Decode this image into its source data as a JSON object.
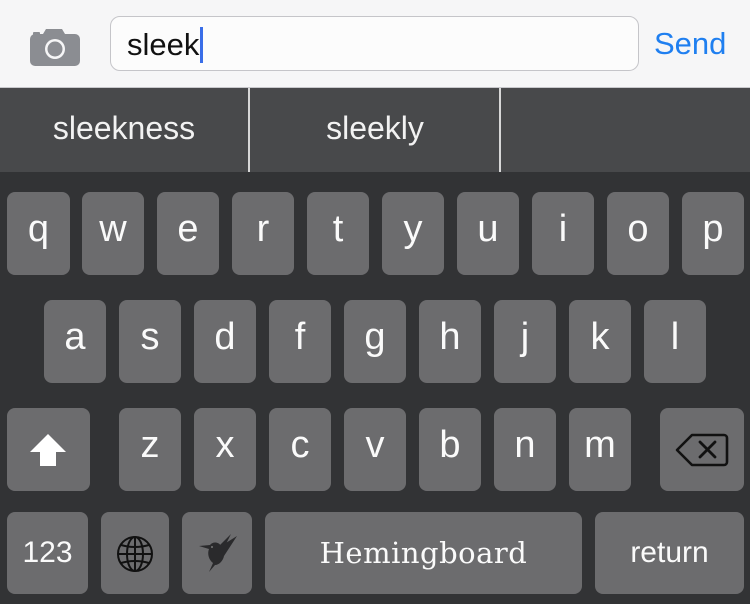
{
  "input_bar": {
    "camera_icon": "camera-icon",
    "text_value": "sleek",
    "send_label": "Send"
  },
  "suggestions": [
    "sleekness",
    "sleekly",
    ""
  ],
  "keyboard": {
    "row1": [
      "q",
      "w",
      "e",
      "r",
      "t",
      "y",
      "u",
      "i",
      "o",
      "p"
    ],
    "row2": [
      "a",
      "s",
      "d",
      "f",
      "g",
      "h",
      "j",
      "k",
      "l"
    ],
    "row3": [
      "z",
      "x",
      "c",
      "v",
      "b",
      "n",
      "m"
    ],
    "numbers_label": "123",
    "space_label": "Hemingboard",
    "return_label": "return",
    "shift_icon": "shift-icon",
    "delete_icon": "delete-icon",
    "globe_icon": "globe-icon",
    "hummingbird_icon": "hummingbird-icon"
  },
  "colors": {
    "accent": "#1f7ff0",
    "caret": "#3a6ee8",
    "key": "#6c6c6e",
    "keyboard_bg": "#323335",
    "suggestion_bg": "#48494b"
  }
}
